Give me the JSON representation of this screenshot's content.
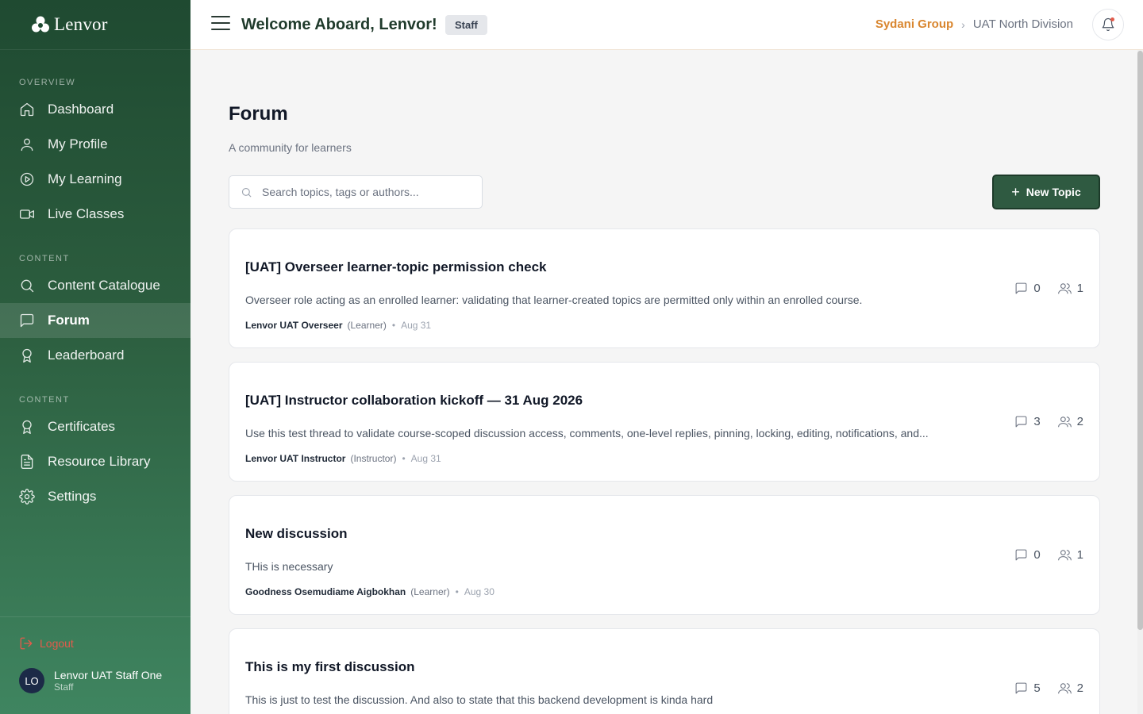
{
  "brand": {
    "name": "Lenvor"
  },
  "sidebar": {
    "sections": [
      "OVERVIEW",
      "CONTENT",
      "CONTENT"
    ],
    "items": [
      {
        "label": "Dashboard",
        "icon": "home-icon"
      },
      {
        "label": "My Profile",
        "icon": "user-icon"
      },
      {
        "label": "My Learning",
        "icon": "play-circle-icon"
      },
      {
        "label": "Live Classes",
        "icon": "video-icon"
      },
      {
        "label": "Content Catalogue",
        "icon": "search-icon"
      },
      {
        "label": "Forum",
        "icon": "message-square-icon",
        "active": true
      },
      {
        "label": "Leaderboard",
        "icon": "award-icon"
      },
      {
        "label": "Certificates",
        "icon": "award-icon"
      },
      {
        "label": "Resource Library",
        "icon": "file-text-icon"
      },
      {
        "label": "Settings",
        "icon": "gear-icon"
      }
    ],
    "logout_label": "Logout",
    "user": {
      "initials": "LO",
      "name": "Lenvor UAT Staff One",
      "role": "Staff"
    }
  },
  "header": {
    "welcome": "Welcome Aboard, Lenvor!",
    "badge": "Staff",
    "breadcrumb": {
      "org": "Sydani Group",
      "division": "UAT North Division"
    }
  },
  "main": {
    "title": "Forum",
    "subtitle": "A community for learners",
    "search_placeholder": "Search topics, tags or authors...",
    "new_topic_label": "New Topic",
    "topics": [
      {
        "title": "[UAT] Overseer learner-topic permission check",
        "excerpt": "Overseer role acting as an enrolled learner: validating that learner-created topics are permitted only within an enrolled course.",
        "author": "Lenvor UAT Overseer",
        "role": "(Learner)",
        "date": "Aug 31",
        "comments": "0",
        "participants": "1"
      },
      {
        "title": "[UAT] Instructor collaboration kickoff — 31 Aug 2026",
        "excerpt": "Use this test thread to validate course-scoped discussion access, comments, one-level replies, pinning, locking, editing, notifications, and...",
        "author": "Lenvor UAT Instructor",
        "role": "(Instructor)",
        "date": "Aug 31",
        "comments": "3",
        "participants": "2"
      },
      {
        "title": "New discussion",
        "excerpt": "THis is necessary",
        "author": "Goodness Osemudiame Aigbokhan",
        "role": "(Learner)",
        "date": "Aug 30",
        "comments": "0",
        "participants": "1"
      },
      {
        "title": "This is my first discussion",
        "excerpt": "This is just to test the discussion. And also to state that this backend development is kinda hard",
        "author": "",
        "role": "",
        "date": "",
        "comments": "5",
        "participants": "2"
      }
    ]
  },
  "colors": {
    "sidebar_top": "#1f4a31",
    "sidebar_bottom": "#3f8560",
    "accent": "#2f5a41",
    "org_link": "#d9862f",
    "logout": "#e25b4b"
  }
}
